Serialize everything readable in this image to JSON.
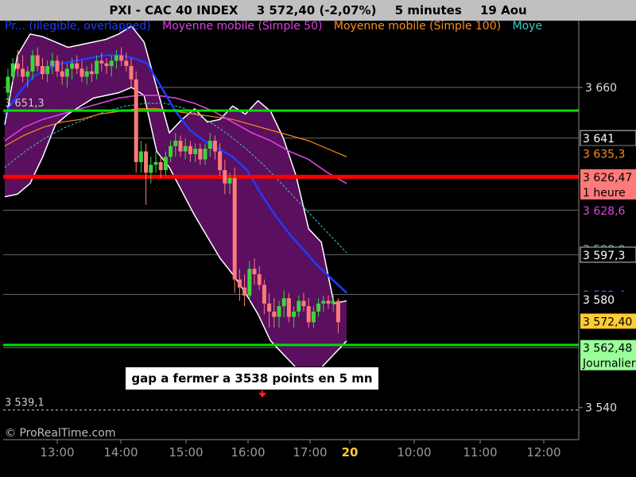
{
  "header": {
    "symbol": "PXI - CAC 40 INDEX",
    "quote": "3 572,40 (-2,07%)",
    "interval": "5 minutes",
    "date": "19 Aou"
  },
  "legend": [
    {
      "label": "Pr... (illegible, overlapped)",
      "color": "#1e3cff"
    },
    {
      "label": "Moyenne mobile (Simple 50)",
      "color": "#e040e0"
    },
    {
      "label": "Moyenne mobile (Simple 100)",
      "color": "#ff8c1a"
    },
    {
      "label": "Moye",
      "color": "#33cccc"
    }
  ],
  "annotation": "gap a fermer a 3538 points en 5 mn",
  "watermark": "© ProRealTime.com",
  "chart_data": {
    "type": "candlestick",
    "x_tick_labels": [
      "13:00",
      "14:00",
      "15:00",
      "16:00",
      "17:00",
      "20",
      "10:00",
      "11:00",
      "12:00"
    ],
    "y_tick_labels": [
      "3 540",
      "3 660"
    ],
    "ylim": [
      3528,
      3685
    ],
    "grid_levels": [
      3660,
      3641,
      3626.5,
      3614,
      3597.3,
      3582.4,
      3562.5
    ],
    "candles": [
      {
        "o": 3658,
        "h": 3667,
        "l": 3655,
        "c": 3664
      },
      {
        "o": 3664,
        "h": 3671,
        "l": 3662,
        "c": 3669
      },
      {
        "o": 3669,
        "h": 3674,
        "l": 3664,
        "c": 3667
      },
      {
        "o": 3667,
        "h": 3672,
        "l": 3662,
        "c": 3664
      },
      {
        "o": 3664,
        "h": 3668,
        "l": 3660,
        "c": 3666
      },
      {
        "o": 3666,
        "h": 3674,
        "l": 3663,
        "c": 3672
      },
      {
        "o": 3672,
        "h": 3675,
        "l": 3666,
        "c": 3668
      },
      {
        "o": 3668,
        "h": 3671,
        "l": 3663,
        "c": 3665
      },
      {
        "o": 3665,
        "h": 3670,
        "l": 3662,
        "c": 3668
      },
      {
        "o": 3668,
        "h": 3673,
        "l": 3665,
        "c": 3670
      },
      {
        "o": 3670,
        "h": 3672,
        "l": 3664,
        "c": 3666
      },
      {
        "o": 3666,
        "h": 3670,
        "l": 3661,
        "c": 3664
      },
      {
        "o": 3664,
        "h": 3669,
        "l": 3660,
        "c": 3667
      },
      {
        "o": 3667,
        "h": 3671,
        "l": 3663,
        "c": 3669
      },
      {
        "o": 3669,
        "h": 3672,
        "l": 3665,
        "c": 3667
      },
      {
        "o": 3667,
        "h": 3670,
        "l": 3662,
        "c": 3664
      },
      {
        "o": 3664,
        "h": 3668,
        "l": 3661,
        "c": 3666
      },
      {
        "o": 3666,
        "h": 3669,
        "l": 3662,
        "c": 3665
      },
      {
        "o": 3665,
        "h": 3672,
        "l": 3663,
        "c": 3670
      },
      {
        "o": 3670,
        "h": 3673,
        "l": 3666,
        "c": 3669
      },
      {
        "o": 3669,
        "h": 3671,
        "l": 3665,
        "c": 3668
      },
      {
        "o": 3668,
        "h": 3672,
        "l": 3664,
        "c": 3670
      },
      {
        "o": 3670,
        "h": 3674,
        "l": 3667,
        "c": 3672
      },
      {
        "o": 3672,
        "h": 3675,
        "l": 3668,
        "c": 3670
      },
      {
        "o": 3670,
        "h": 3673,
        "l": 3666,
        "c": 3668
      },
      {
        "o": 3668,
        "h": 3671,
        "l": 3660,
        "c": 3663
      },
      {
        "o": 3663,
        "h": 3666,
        "l": 3628,
        "c": 3632
      },
      {
        "o": 3632,
        "h": 3640,
        "l": 3628,
        "c": 3636
      },
      {
        "o": 3636,
        "h": 3639,
        "l": 3616,
        "c": 3628
      },
      {
        "o": 3628,
        "h": 3634,
        "l": 3624,
        "c": 3631
      },
      {
        "o": 3631,
        "h": 3636,
        "l": 3628,
        "c": 3632
      },
      {
        "o": 3632,
        "h": 3634,
        "l": 3626,
        "c": 3629
      },
      {
        "o": 3629,
        "h": 3636,
        "l": 3627,
        "c": 3634
      },
      {
        "o": 3634,
        "h": 3640,
        "l": 3632,
        "c": 3638
      },
      {
        "o": 3638,
        "h": 3643,
        "l": 3634,
        "c": 3640
      },
      {
        "o": 3640,
        "h": 3642,
        "l": 3634,
        "c": 3636
      },
      {
        "o": 3636,
        "h": 3641,
        "l": 3633,
        "c": 3638
      },
      {
        "o": 3638,
        "h": 3640,
        "l": 3632,
        "c": 3635
      },
      {
        "o": 3635,
        "h": 3639,
        "l": 3632,
        "c": 3637
      },
      {
        "o": 3637,
        "h": 3639,
        "l": 3631,
        "c": 3633
      },
      {
        "o": 3633,
        "h": 3639,
        "l": 3631,
        "c": 3637
      },
      {
        "o": 3637,
        "h": 3643,
        "l": 3634,
        "c": 3640
      },
      {
        "o": 3640,
        "h": 3642,
        "l": 3633,
        "c": 3636
      },
      {
        "o": 3636,
        "h": 3639,
        "l": 3627,
        "c": 3629
      },
      {
        "o": 3629,
        "h": 3633,
        "l": 3620,
        "c": 3624
      },
      {
        "o": 3624,
        "h": 3628,
        "l": 3620,
        "c": 3626
      },
      {
        "o": 3626,
        "h": 3630,
        "l": 3583,
        "c": 3588
      },
      {
        "o": 3588,
        "h": 3592,
        "l": 3580,
        "c": 3585
      },
      {
        "o": 3585,
        "h": 3590,
        "l": 3578,
        "c": 3582
      },
      {
        "o": 3582,
        "h": 3595,
        "l": 3580,
        "c": 3592
      },
      {
        "o": 3592,
        "h": 3596,
        "l": 3586,
        "c": 3590
      },
      {
        "o": 3590,
        "h": 3593,
        "l": 3584,
        "c": 3586
      },
      {
        "o": 3586,
        "h": 3588,
        "l": 3575,
        "c": 3579
      },
      {
        "o": 3579,
        "h": 3583,
        "l": 3570,
        "c": 3576
      },
      {
        "o": 3576,
        "h": 3581,
        "l": 3570,
        "c": 3574
      },
      {
        "o": 3574,
        "h": 3580,
        "l": 3570,
        "c": 3578
      },
      {
        "o": 3578,
        "h": 3584,
        "l": 3574,
        "c": 3581
      },
      {
        "o": 3581,
        "h": 3583,
        "l": 3572,
        "c": 3574
      },
      {
        "o": 3574,
        "h": 3578,
        "l": 3570,
        "c": 3576
      },
      {
        "o": 3576,
        "h": 3582,
        "l": 3574,
        "c": 3580
      },
      {
        "o": 3580,
        "h": 3583,
        "l": 3576,
        "c": 3578
      },
      {
        "o": 3578,
        "h": 3581,
        "l": 3570,
        "c": 3572
      },
      {
        "o": 3572,
        "h": 3578,
        "l": 3570,
        "c": 3576
      },
      {
        "o": 3576,
        "h": 3581,
        "l": 3574,
        "c": 3579
      },
      {
        "o": 3579,
        "h": 3582,
        "l": 3576,
        "c": 3580
      },
      {
        "o": 3580,
        "h": 3582,
        "l": 3577,
        "c": 3579
      },
      {
        "o": 3579,
        "h": 3582,
        "l": 3576,
        "c": 3580
      },
      {
        "o": 3580,
        "h": 3581,
        "l": 3568,
        "c": 3572
      }
    ],
    "bollinger_upper": [
      3646,
      3672,
      3680,
      3679,
      3677,
      3675,
      3676,
      3677,
      3678,
      3680,
      3683,
      3677,
      3660,
      3643,
      3648,
      3652,
      3647,
      3648,
      3653,
      3650,
      3655,
      3651,
      3641,
      3627,
      3607,
      3602,
      3579,
      3580
    ],
    "bollinger_lower": [
      3619,
      3620,
      3624,
      3634,
      3646,
      3650,
      3653,
      3656,
      3657,
      3658,
      3660,
      3657,
      3636,
      3630,
      3621,
      3612,
      3604,
      3596,
      3590,
      3583,
      3575,
      3565,
      3560,
      3555,
      3554,
      3555,
      3560,
      3565
    ],
    "sma_20": [
      3650,
      3658,
      3664,
      3667,
      3669,
      3670,
      3671,
      3672,
      3672,
      3671,
      3669,
      3660,
      3651,
      3644,
      3640,
      3637,
      3634,
      3629,
      3620,
      3612,
      3605,
      3599,
      3593,
      3588,
      3583
    ],
    "sma_50": [
      3640,
      3645,
      3648,
      3650,
      3652,
      3654,
      3656,
      3657,
      3657,
      3656,
      3654,
      3651,
      3647,
      3643,
      3640,
      3636,
      3633,
      3628,
      3624
    ],
    "sma_100": [
      3638,
      3642,
      3645,
      3647,
      3648,
      3650,
      3651,
      3652,
      3652,
      3651,
      3650,
      3649,
      3648,
      3646,
      3644,
      3642,
      3640,
      3637,
      3634
    ],
    "sma_cyan": [
      3630,
      3636,
      3641,
      3645,
      3648,
      3651,
      3653,
      3654,
      3654,
      3652,
      3648,
      3643,
      3637,
      3630,
      3622,
      3614,
      3606,
      3598
    ],
    "horizontal_lines": [
      {
        "value": 3651.3,
        "label": "3 651,3",
        "color": "#00e000"
      },
      {
        "value": 3626.5,
        "color": "#ff0000"
      },
      {
        "value": 3563.5,
        "color": "#00e000"
      },
      {
        "value": 3539.1,
        "label": "3 539,1",
        "color": "#cccccc",
        "dashed": true
      }
    ],
    "price_tags": [
      {
        "label": "3 641",
        "value": 3641,
        "bg": "#000000",
        "fg": "#ffffff",
        "border": "#cccccc"
      },
      {
        "label": "3 635,3",
        "value": 3635.3,
        "bg": "#000000",
        "fg": "#ff8c1a"
      },
      {
        "label": "3 626,47\n1 heure",
        "value": 3626.5,
        "bg": "#ff7a7a",
        "fg": "#000000"
      },
      {
        "label": "3 628,6",
        "value": 3614,
        "bg": "#000000",
        "fg": "#e040e0"
      },
      {
        "label": "3 598,0",
        "value": 3599.5,
        "bg": "#000000",
        "fg": "#33cccc"
      },
      {
        "label": "3 597,3",
        "value": 3597.3,
        "bg": "#000000",
        "fg": "#ffffff",
        "border": "#cccccc"
      },
      {
        "label": "3 582,4",
        "value": 3582.4,
        "bg": "#000000",
        "fg": "#a040ff"
      },
      {
        "label": "3 580",
        "value": 3580.6,
        "bg": "#000000",
        "fg": "#ffffff"
      },
      {
        "label": "3 572,40",
        "value": 3572.4,
        "bg": "#ffcc33",
        "fg": "#000000"
      },
      {
        "label": "3 562,48\nJournalier",
        "value": 3562.5,
        "bg": "#99ff99",
        "fg": "#000000"
      }
    ]
  },
  "colors": {
    "background": "#000000",
    "band_fill": "#5a0f5f",
    "up_candle": "#3cd33c",
    "down_candle": "#ff7a7a",
    "axis_text": "#dddddd"
  }
}
